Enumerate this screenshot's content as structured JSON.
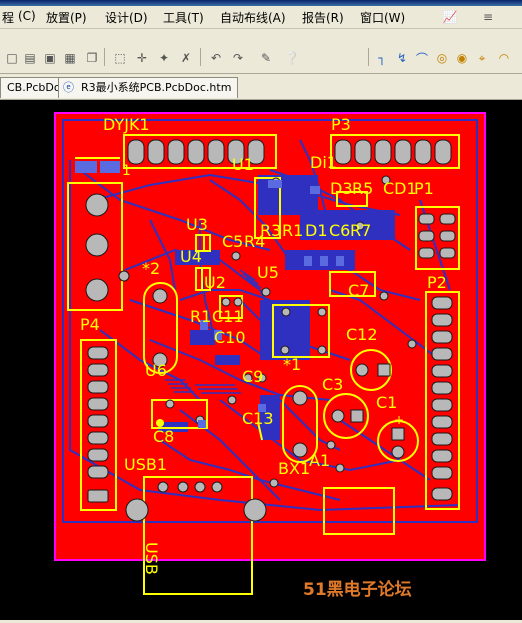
{
  "menu": {
    "items": [
      {
        "label": "程"
      },
      {
        "label": "(C)"
      },
      {
        "label": "放置(P)"
      },
      {
        "label": "设计(D)"
      },
      {
        "label": "工具(T)"
      },
      {
        "label": "自动布线(A)"
      },
      {
        "label": "报告(R)"
      },
      {
        "label": "窗口(W)"
      }
    ]
  },
  "tabs": [
    {
      "label": "CB.PcbDoc"
    },
    {
      "label": "R3最小系统PCB.PcbDoc.htm"
    }
  ],
  "pcb": {
    "designators": {
      "dyjk1": "DYJK1",
      "p3": "P3",
      "u1": "U1",
      "di1": "Di1",
      "d3": "D3",
      "r5": "R5",
      "cd1": "CD1",
      "p1": "P1",
      "u3": "U3",
      "r3": "R3",
      "r1d": "R1",
      "di": "D1",
      "c6": "C6",
      "r7": "R7",
      "u4": "U4",
      "c5": "C5",
      "r4": "R4",
      "u5": "U5",
      "u2": "U2",
      "c7": "C7",
      "p2": "P2",
      "star2": "*2",
      "r1": "R1",
      "c11": "C11",
      "c10": "C10",
      "c12": "C12",
      "p4": "P4",
      "star1": "*1",
      "u6": "U6",
      "c9": "C9",
      "c3": "C3",
      "c1": "C1",
      "c13": "C13",
      "c8": "C8",
      "usb1": "USB1",
      "bx1": "BX1",
      "a1": "A1",
      "usb": "USB",
      "one": "1",
      "plus": "+"
    }
  },
  "watermark": "51黑电子论坛",
  "colors": {
    "board": "#FF0000",
    "silkscreen": "#FFFF00",
    "bottom_layer": "#3030C0",
    "keepout": "#FF00FF",
    "pad": "#B8B8B8",
    "background": "#000000"
  },
  "toolbar_icons": [
    "new-icon",
    "open-icon",
    "save-icon",
    "print-icon",
    "copy-icon",
    "paste-icon",
    "select-icon",
    "move-icon",
    "cross-select-icon",
    "deselect-icon",
    "undo-icon",
    "redo-icon",
    "pencil-icon",
    "wire-icon",
    "route-icon",
    "arc-icon",
    "pad-icon",
    "via-icon",
    "component-icon",
    "chart-icon",
    "layer-icon"
  ]
}
